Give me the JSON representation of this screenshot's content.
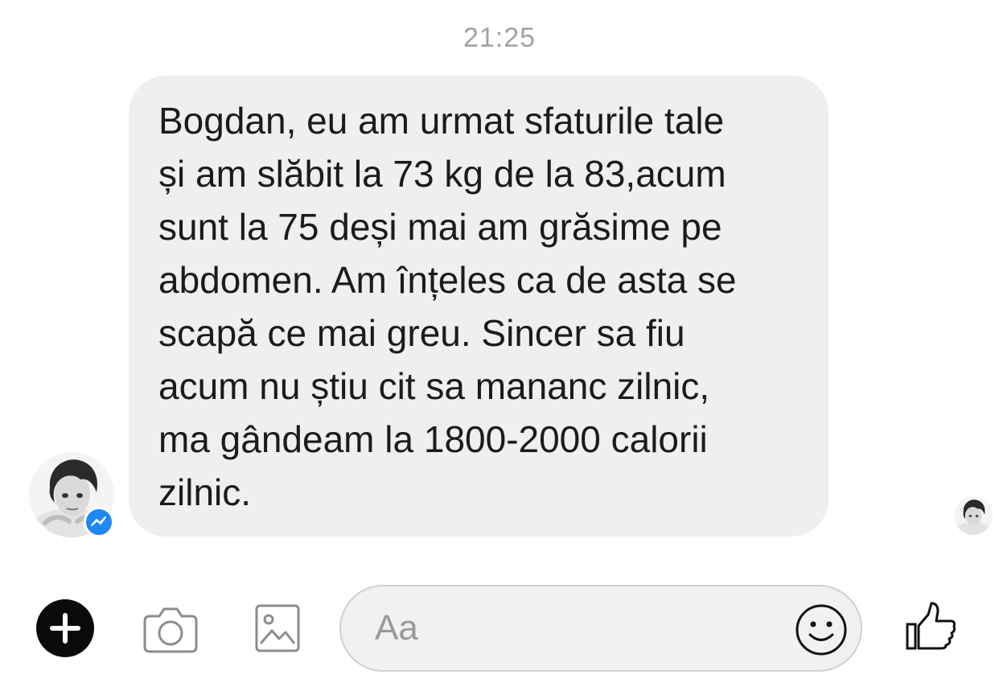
{
  "conversation": {
    "timestamp": "21:25"
  },
  "message": {
    "lines": [
      "Bogdan, eu am urmat sfaturile tale",
      "și am slăbit la 73 kg de la 83,acum",
      "sunt la 75 deși mai am grăsime pe",
      "abdomen. Am înțeles ca de asta se",
      "scapă ce mai greu. Sincer sa fiu",
      "acum nu știu cit sa mananc zilnic,",
      "ma gândeam la 1800-2000 calorii",
      "zilnic."
    ]
  },
  "sender": {
    "avatar_icon": "user-avatar-icon",
    "badge_icon": "messenger-badge-icon",
    "badge_color": "#1e88f4"
  },
  "composer": {
    "placeholder": "Aa",
    "value": "",
    "icons": {
      "add": "plus-icon",
      "camera": "camera-icon",
      "gallery": "image-icon",
      "emoji": "smiley-icon",
      "like": "thumbs-up-icon"
    }
  },
  "colors": {
    "bubble_background": "#efefef",
    "timestamp_text": "#a2a2a2",
    "message_text": "#1b1b1b"
  }
}
